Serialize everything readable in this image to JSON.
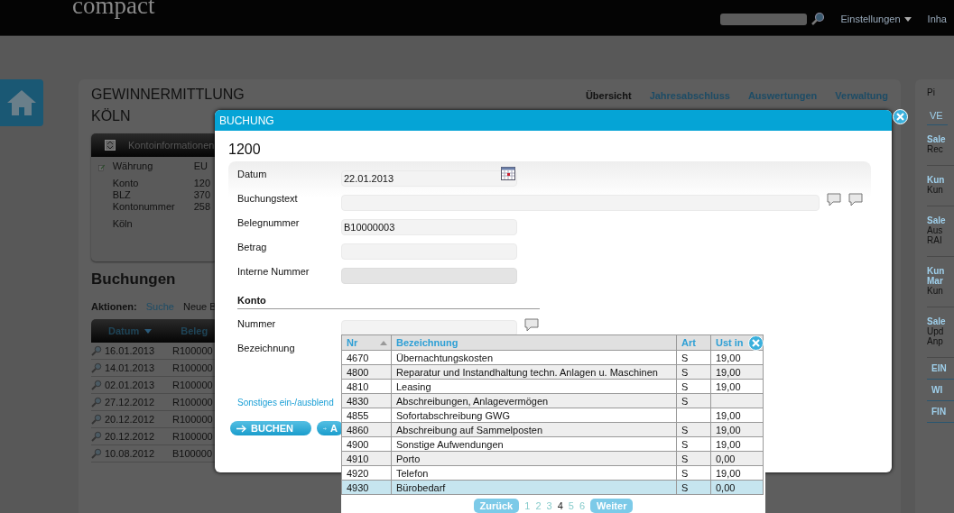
{
  "topbar": {
    "logo": "compact",
    "menu": [
      {
        "label": "Einstellungen",
        "kind": "dropdown"
      },
      {
        "label": "Inha",
        "kind": "plain"
      }
    ]
  },
  "page": {
    "title": "GEWINNERMITTLUNG",
    "nav": [
      {
        "label": "Übersicht",
        "selected": true
      },
      {
        "label": "Jahresabschluss",
        "selected": false
      },
      {
        "label": "Auswertungen",
        "selected": false
      },
      {
        "label": "Verwaltung",
        "selected": false
      }
    ],
    "bank_title": "KÖLN",
    "info_panel": {
      "title": "Kontoinformationen",
      "rows": [
        {
          "label": "Währung",
          "value": "EU"
        },
        {
          "label": "Konto",
          "value": "120"
        },
        {
          "label": "BLZ",
          "value": "370"
        },
        {
          "label": "Kontonummer",
          "value": "258"
        }
      ],
      "city": "Köln"
    },
    "section": "Buchungen",
    "actions_label": "Aktionen:",
    "actions": [
      "Suche",
      "Neue B"
    ],
    "table": {
      "columns": [
        {
          "label": "Datum",
          "sorted": true
        },
        {
          "label": "Beleg",
          "sorted": false
        }
      ],
      "rows": [
        [
          "16.01.2013",
          "R100000"
        ],
        [
          "14.01.2013",
          "R100000"
        ],
        [
          "02.01.2013",
          "R100000"
        ],
        [
          "27.12.2012",
          "R100000"
        ],
        [
          "20.12.2012",
          "R100000"
        ],
        [
          "20.12.2012",
          "R100000"
        ],
        [
          "10.08.2012",
          "B100000"
        ]
      ]
    }
  },
  "sidebar": {
    "title": "Pi",
    "heading": "VE",
    "groups": [
      {
        "title": [
          "Sale"
        ],
        "lines": [
          "Rec"
        ]
      },
      {
        "title": [
          "Kun"
        ],
        "lines": [
          "Kun"
        ]
      },
      {
        "title": [
          "Sale"
        ],
        "lines": [
          "Aus",
          "RAI"
        ]
      },
      {
        "title": [
          "Kun",
          "Mar"
        ],
        "lines": [
          "Kun"
        ]
      },
      {
        "title": [
          "Sale"
        ],
        "lines": [
          "Upd",
          "Anp"
        ]
      }
    ],
    "links": [
      "EIN",
      "WI",
      "FIN"
    ]
  },
  "dialog": {
    "title": "BUCHUNG",
    "heading": "1200",
    "fields": [
      {
        "label": "Datum",
        "value": "22.01.2013",
        "kind": "date"
      },
      {
        "label": "Buchungstext",
        "kind": "comment"
      },
      {
        "label": "Belegnummer",
        "value": "B10000003",
        "kind": "text"
      },
      {
        "label": "Betrag",
        "kind": "text"
      },
      {
        "label": "Interne Nummer",
        "disabled": true,
        "kind": "text"
      }
    ],
    "section": "Konto",
    "konto_fields": [
      {
        "label": "Nummer",
        "kind": "lookup"
      },
      {
        "label": "Bezeichnung",
        "kind": "none"
      }
    ],
    "link": "Sonstiges ein-/ausblend",
    "buttons": [
      "BUCHEN",
      "A"
    ]
  },
  "lookup": {
    "columns": [
      {
        "label": "Nr",
        "sorted": true
      },
      {
        "label": "Bezeichnung",
        "sorted": false
      },
      {
        "label": "Art",
        "sorted": false
      },
      {
        "label": "Ust in",
        "sorted": false
      }
    ],
    "rows": [
      {
        "cells": [
          "4670",
          "Übernachtungskosten",
          "S",
          "19,00"
        ],
        "selected": false
      },
      {
        "cells": [
          "4800",
          "Reparatur und Instandhaltung techn. Anlagen u. Maschinen",
          "S",
          "19,00"
        ],
        "selected": false
      },
      {
        "cells": [
          "4810",
          "Leasing",
          "S",
          "19,00"
        ],
        "selected": false
      },
      {
        "cells": [
          "4830",
          "Abschreibungen, Anlagevermögen",
          "S",
          ""
        ],
        "selected": false
      },
      {
        "cells": [
          "4855",
          "Sofortabschreibung GWG",
          "",
          "19,00"
        ],
        "selected": false
      },
      {
        "cells": [
          "4860",
          "Abschreibung auf Sammelposten",
          "S",
          "19,00"
        ],
        "selected": false
      },
      {
        "cells": [
          "4900",
          "Sonstige Aufwendungen",
          "S",
          "19,00"
        ],
        "selected": false
      },
      {
        "cells": [
          "4910",
          "Porto",
          "S",
          "0,00"
        ],
        "selected": false
      },
      {
        "cells": [
          "4920",
          "Telefon",
          "S",
          "19,00"
        ],
        "selected": false
      },
      {
        "cells": [
          "4930",
          "Bürobedarf",
          "S",
          "0,00"
        ],
        "selected": true
      }
    ],
    "pager": {
      "prev": "Zurück",
      "pages": [
        {
          "label": "1",
          "selected": false
        },
        {
          "label": "2",
          "selected": false
        },
        {
          "label": "3",
          "selected": false
        },
        {
          "label": "4",
          "selected": true
        },
        {
          "label": "5",
          "selected": false
        },
        {
          "label": "6",
          "selected": false
        }
      ],
      "next": "Weiter"
    }
  }
}
